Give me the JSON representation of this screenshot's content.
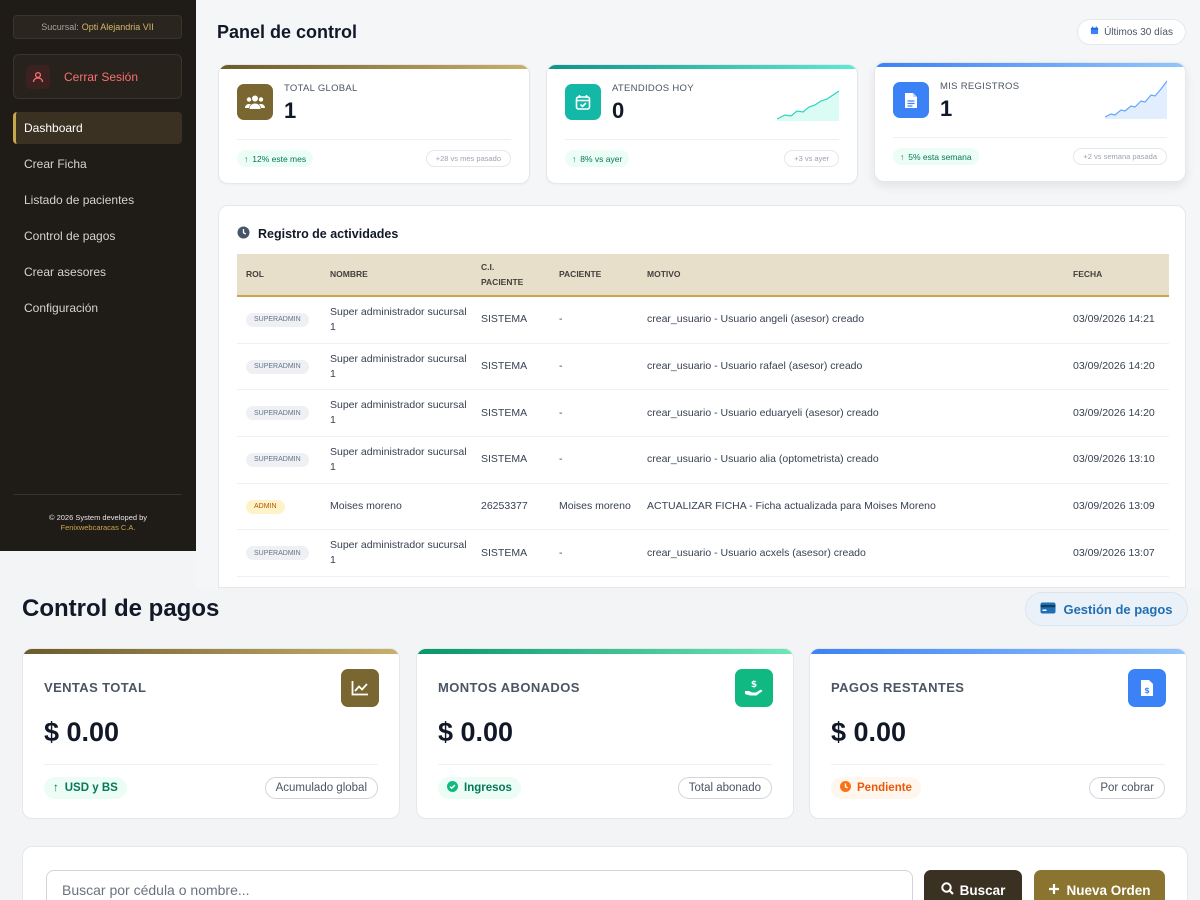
{
  "sidebar": {
    "sucursal_label": "Sucursal:",
    "sucursal_name": "Opti Alejandria VII",
    "logout_label": "Cerrar Sesión",
    "nav": [
      {
        "label": "Dashboard",
        "active": true
      },
      {
        "label": "Crear Ficha"
      },
      {
        "label": "Listado de pacientes"
      },
      {
        "label": "Control de pagos"
      },
      {
        "label": "Crear asesores"
      },
      {
        "label": "Configuración"
      }
    ],
    "footer_line1": "© 2026 System developed by",
    "footer_line2": "Fenixwebcaracas C.A."
  },
  "dashboard": {
    "title": "Panel de control",
    "range_label": "Últimos 30 días",
    "stats": [
      {
        "label": "TOTAL GLOBAL",
        "value": "1",
        "trend": "12% este mes",
        "compare": "+28 vs mes pasado",
        "icon": "users-icon",
        "color": "#8a7430"
      },
      {
        "label": "ATENDIDOS HOY",
        "value": "0",
        "trend": "8% vs ayer",
        "compare": "+3 vs ayer",
        "icon": "calendar-check-icon",
        "color": "#14b8a6"
      },
      {
        "label": "MIS REGISTROS",
        "value": "1",
        "trend": "5% esta semana",
        "compare": "+2 vs semana pasada",
        "icon": "document-icon",
        "color": "#3b82f6"
      }
    ]
  },
  "activity": {
    "title": "Registro de actividades",
    "columns": [
      "ROL",
      "NOMBRE",
      "C.I. PACIENTE",
      "PACIENTE",
      "MOTIVO",
      "FECHA"
    ],
    "rows": [
      {
        "rol": "SUPERADMIN",
        "nombre": "Super administrador sucursal 1",
        "ci": "SISTEMA",
        "paciente": "-",
        "motivo": "crear_usuario - Usuario angeli (asesor) creado",
        "fecha": "03/09/2026 14:21"
      },
      {
        "rol": "SUPERADMIN",
        "nombre": "Super administrador sucursal 1",
        "ci": "SISTEMA",
        "paciente": "-",
        "motivo": "crear_usuario - Usuario rafael (asesor) creado",
        "fecha": "03/09/2026 14:20"
      },
      {
        "rol": "SUPERADMIN",
        "nombre": "Super administrador sucursal 1",
        "ci": "SISTEMA",
        "paciente": "-",
        "motivo": "crear_usuario - Usuario eduaryeli (asesor) creado",
        "fecha": "03/09/2026 14:20"
      },
      {
        "rol": "SUPERADMIN",
        "nombre": "Super administrador sucursal 1",
        "ci": "SISTEMA",
        "paciente": "-",
        "motivo": "crear_usuario - Usuario alia (optometrista) creado",
        "fecha": "03/09/2026 13:10"
      },
      {
        "rol": "ADMIN",
        "nombre": "Moises moreno",
        "ci": "26253377",
        "paciente": "Moises moreno",
        "motivo": "ACTUALIZAR FICHA - Ficha actualizada para Moises Moreno",
        "fecha": "03/09/2026 13:09"
      },
      {
        "rol": "SUPERADMIN",
        "nombre": "Super administrador sucursal 1",
        "ci": "SISTEMA",
        "paciente": "-",
        "motivo": "crear_usuario - Usuario acxels (asesor) creado",
        "fecha": "03/09/2026 13:07"
      }
    ]
  },
  "pagos": {
    "title": "Control de pagos",
    "gestion_label": "Gestión de pagos",
    "cards": [
      {
        "label": "VENTAS TOTAL",
        "value": "$ 0.00",
        "chip_left": "USD y BS",
        "chip_right": "Acumulado global",
        "icon": "chart-line-icon",
        "color": "#8a7430"
      },
      {
        "label": "MONTOS ABONADOS",
        "value": "$ 0.00",
        "chip_left": "Ingresos",
        "chip_right": "Total abonado",
        "icon": "hand-dollar-icon",
        "color": "#10b981"
      },
      {
        "label": "PAGOS RESTANTES",
        "value": "$ 0.00",
        "chip_left": "Pendiente",
        "chip_right": "Por cobrar",
        "icon": "invoice-dollar-icon",
        "color": "#3b82f6"
      }
    ],
    "search_placeholder": "Buscar por cédula o nombre...",
    "search_button": "Buscar",
    "new_order_button": "Nueva Orden"
  }
}
